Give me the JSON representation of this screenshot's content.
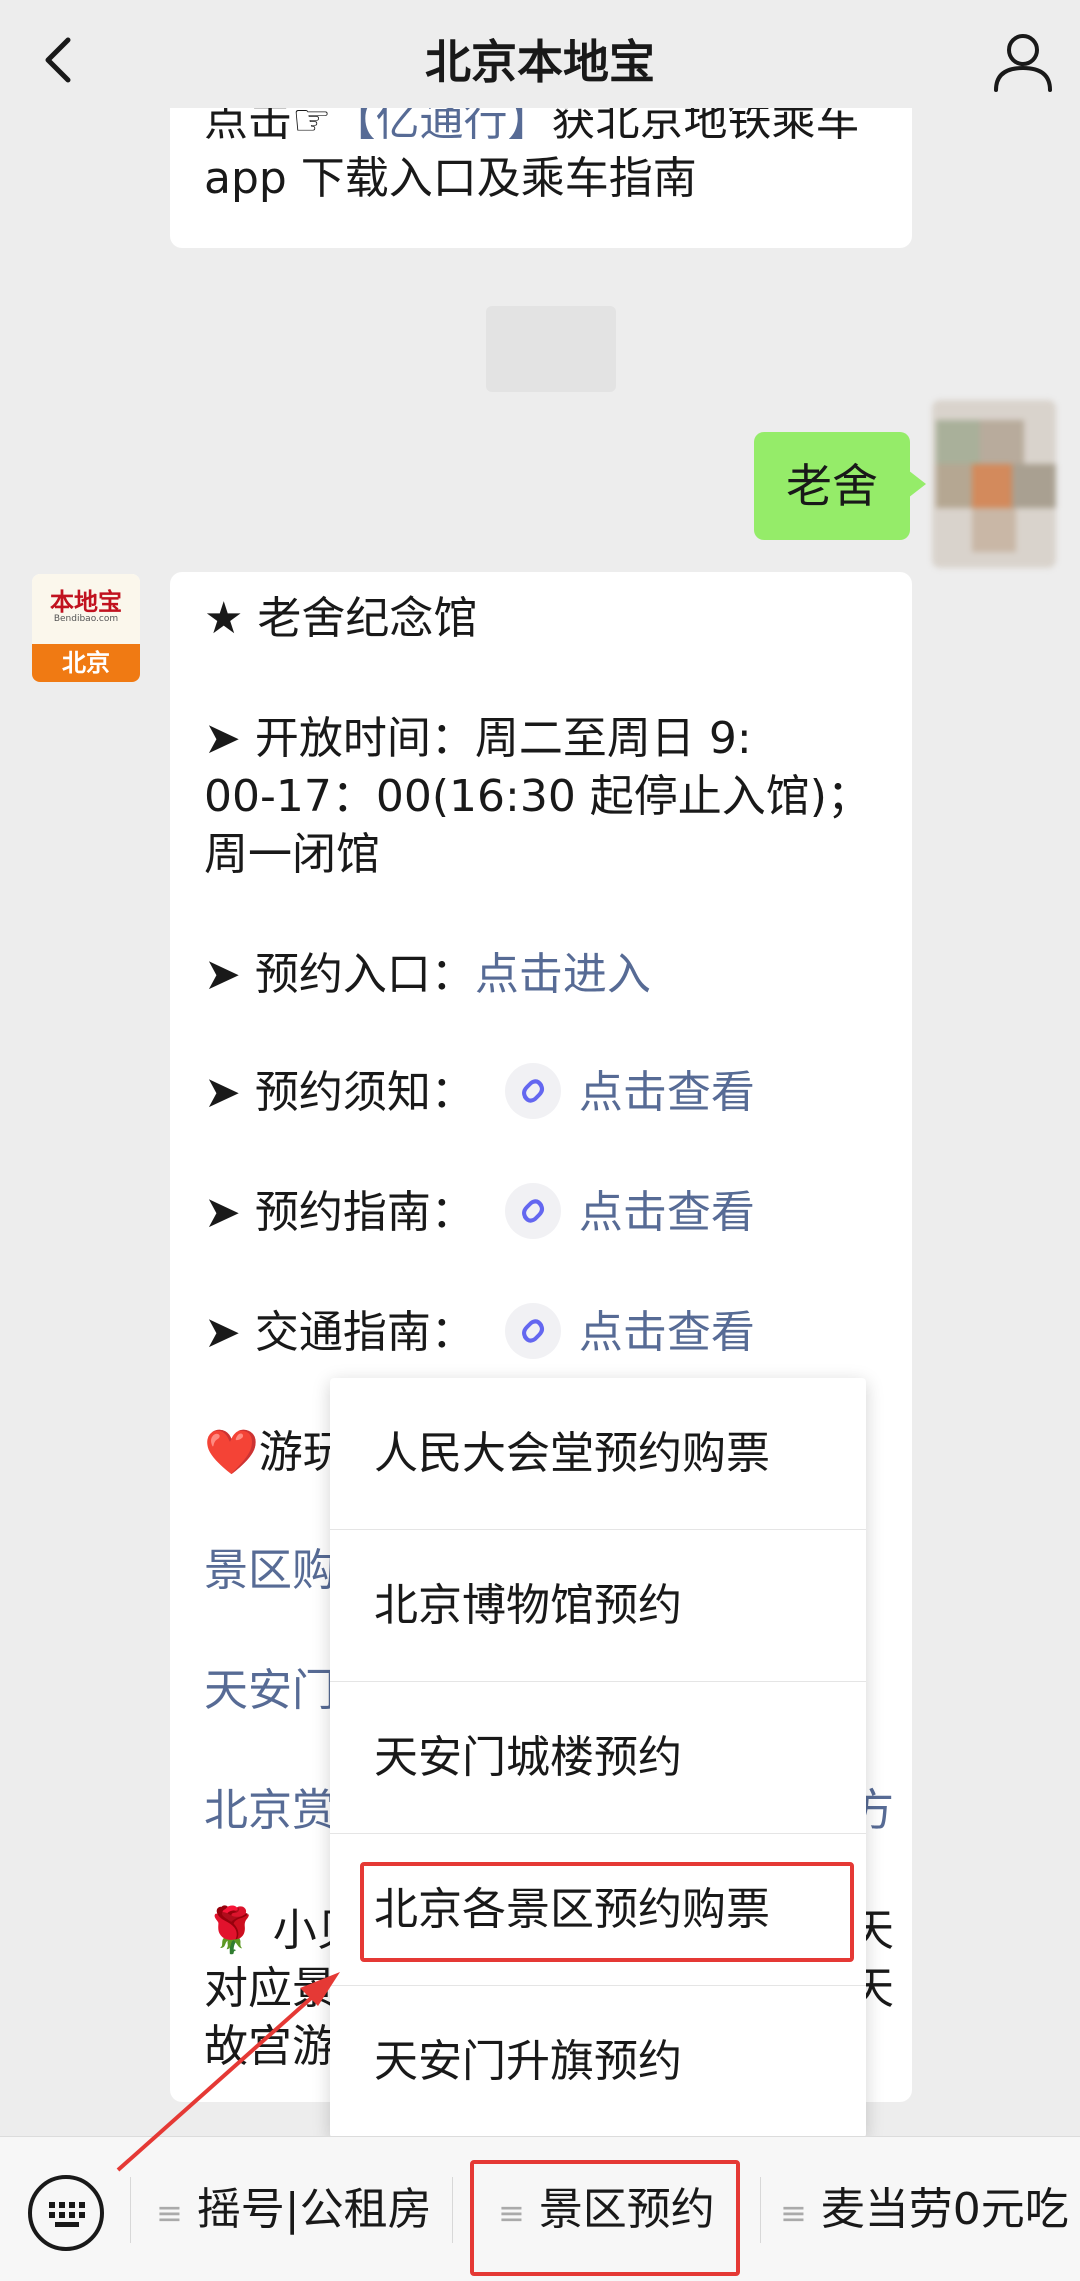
{
  "header": {
    "title": "北京本地宝",
    "back_icon": "chevron-left-icon",
    "profile_icon": "person-icon"
  },
  "top_message": {
    "prefix": "点击",
    "pointer_icon": "☞",
    "link_text": "【亿通行】",
    "suffix": "获北京地铁乘车",
    "line2": "app 下载入口及乘车指南"
  },
  "user_message": {
    "text": "老舍"
  },
  "bot_avatar": {
    "logo_text": "本地宝",
    "logo_sub": "Bendibao.com",
    "city": "北京"
  },
  "main_message": {
    "title": "★ 老舍纪念馆",
    "hours_label": "➤ 开放时间：",
    "hours_line1": "周二至周日 9:",
    "hours_line2": "00-17：00(16:30 起停止入馆)；",
    "hours_line3": "周一闭馆",
    "reserve_label": "➤ 预约入口：",
    "reserve_link": "点击进入",
    "notice_label": "➤ 预约须知：",
    "notice_link": "点击查看",
    "guide_label": "➤ 预约指南：",
    "guide_link": "点击查看",
    "traffic_label": "➤ 交通指南：",
    "traffic_link": "点击查看",
    "play_prefix": "❤️游玩",
    "link_row1": "景区购",
    "link_row2": "天安门",
    "link_row3": "北京赏",
    "link_row3_tail": "方",
    "tip_line1": "🌹 小贝",
    "tip_line1_tail": "天",
    "tip_line2": "对应景",
    "tip_line2_tail": "天",
    "tip_line3": "故宫游"
  },
  "popup_menu": {
    "items": [
      "人民大会堂预约购票",
      "北京博物馆预约",
      "天安门城楼预约",
      "北京各景区预约购票",
      "天安门升旗预约"
    ]
  },
  "bottom_bar": {
    "keyboard_icon": "keyboard-icon",
    "menus": [
      "摇号|公租房",
      "景区预约",
      "麦当劳0元吃"
    ],
    "menu_icon": "≡"
  },
  "colors": {
    "link": "#576b95",
    "self_bubble": "#95ec69",
    "highlight": "#e53935",
    "brand_orange": "#f07a13"
  }
}
